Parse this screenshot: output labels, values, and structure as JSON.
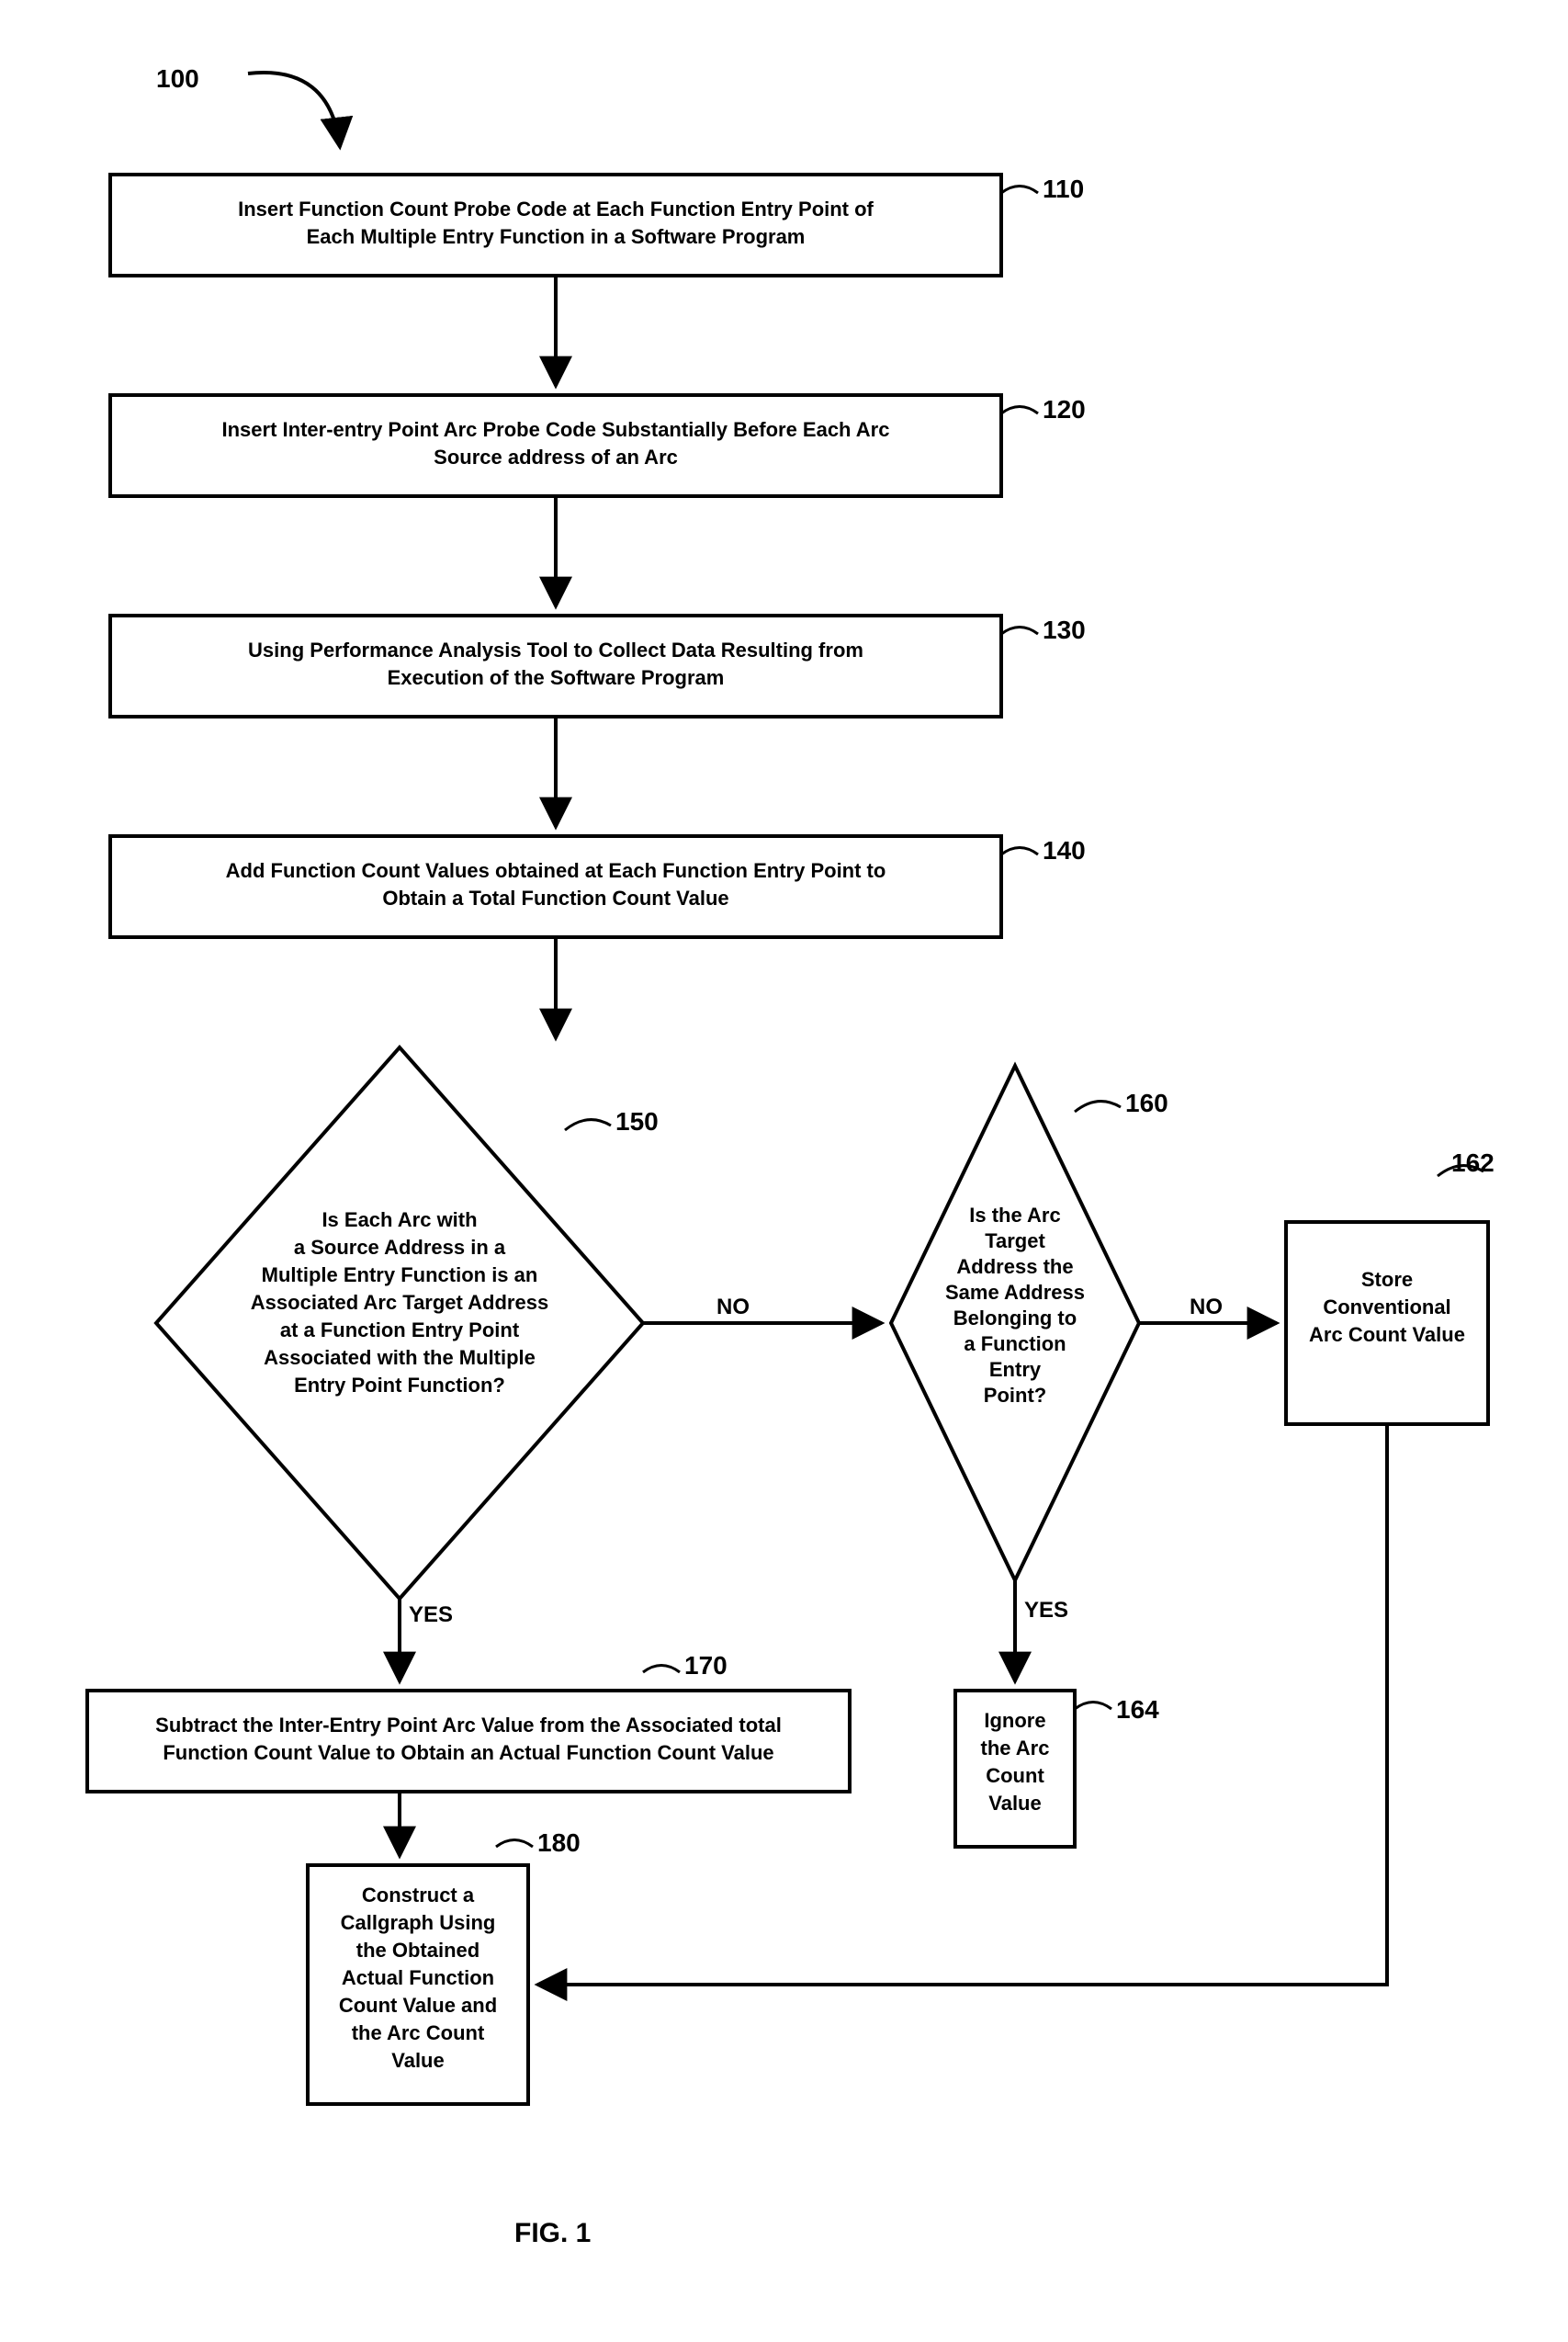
{
  "figure_label": "FIG. 1",
  "flow_number": "100",
  "nodes": {
    "n110": {
      "num": "110",
      "lines": [
        "Insert Function Count Probe Code at Each Function Entry Point of",
        "Each Multiple Entry Function in a Software Program"
      ]
    },
    "n120": {
      "num": "120",
      "lines": [
        "Insert Inter-entry Point Arc Probe Code Substantially Before Each Arc",
        "Source address of an Arc"
      ]
    },
    "n130": {
      "num": "130",
      "lines": [
        "Using Performance Analysis Tool to Collect Data Resulting from",
        "Execution of the Software Program"
      ]
    },
    "n140": {
      "num": "140",
      "lines": [
        "Add Function Count Values obtained at Each Function Entry Point to",
        "Obtain a Total Function Count Value"
      ]
    },
    "n150": {
      "num": "150",
      "lines": [
        "Is Each Arc with",
        "a Source Address in a",
        "Multiple Entry Function is an",
        "Associated Arc Target Address",
        "at a Function Entry Point",
        "Associated with the Multiple",
        "Entry Point Function?"
      ]
    },
    "n160": {
      "num": "160",
      "lines": [
        "Is the Arc",
        "Target",
        "Address the",
        "Same Address",
        "Belonging to",
        "a Function",
        "Entry",
        "Point?"
      ]
    },
    "n162": {
      "num": "162",
      "lines": [
        "Store",
        "Conventional",
        "Arc Count Value"
      ]
    },
    "n164": {
      "num": "164",
      "lines": [
        "Ignore",
        "the Arc",
        "Count",
        "Value"
      ]
    },
    "n170": {
      "num": "170",
      "lines": [
        "Subtract the Inter-Entry Point Arc Value from the Associated total",
        "Function Count Value to Obtain an Actual Function Count Value"
      ]
    },
    "n180": {
      "num": "180",
      "lines": [
        "Construct a",
        "Callgraph Using",
        "the Obtained",
        "Actual Function",
        "Count Value and",
        "the Arc Count",
        "Value"
      ]
    }
  },
  "edges": {
    "no1": "NO",
    "no2": "NO",
    "yes1": "YES",
    "yes2": "YES"
  }
}
